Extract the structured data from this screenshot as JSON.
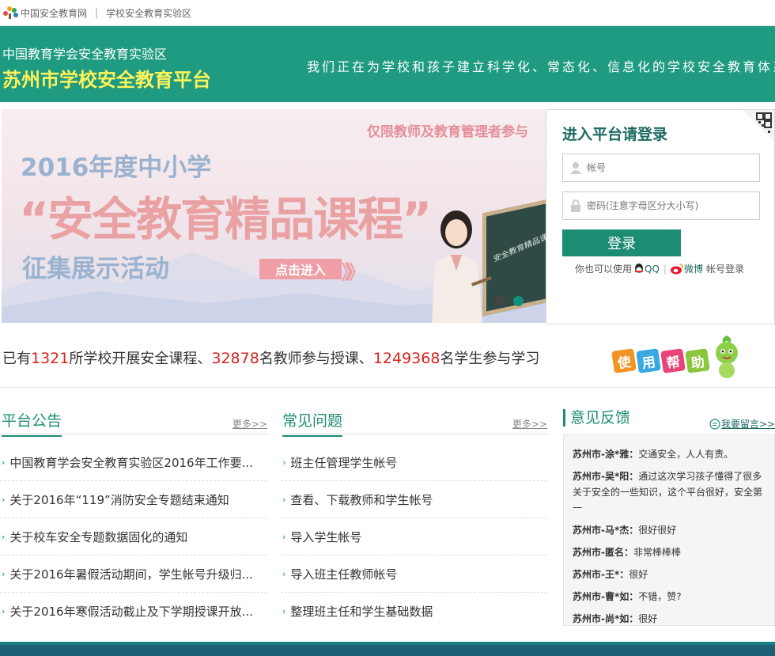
{
  "topbar": {
    "site1": "中国安全教育网",
    "separator": "|",
    "site2": "学校安全教育实验区"
  },
  "header": {
    "org": "中国教育学会安全教育实验区",
    "title": "苏州市学校安全教育平台",
    "slogan": "我们正在为学校和孩子建立科学化、常态化、信息化的学校安全教育体系"
  },
  "banner": {
    "limit_note": "仅限教师及教育管理者参与",
    "year_line": "2016年度中小学",
    "course_line": "“安全教育精品课程”",
    "event_line": "征集展示活动",
    "enter_label": "点击进入",
    "arrows": "》》",
    "board_text": "安全教育精品课"
  },
  "login": {
    "title": "进入平台请登录",
    "account_placeholder": "帐号",
    "password_placeholder": "密码(注意字母区分大小写)",
    "login_label": "登录",
    "alt_prefix": "你也可以使用",
    "qq": "QQ",
    "pipe": "|",
    "weibo": "微博",
    "alt_suffix": "帐号登录"
  },
  "stats": {
    "p1": "已有",
    "schools": "1321",
    "p2": "所学校开展安全课程、",
    "teachers": "32878",
    "p3": "名教师参与授课、",
    "students": "1249368",
    "p4": "名学生参与学习"
  },
  "help": {
    "tiles": [
      "使",
      "用",
      "帮",
      "助"
    ],
    "colors": [
      "#f29423",
      "#3aa9e0",
      "#e9447a",
      "#8cc63f"
    ]
  },
  "announcements": {
    "title": "平台公告",
    "more": "更多>>",
    "items": [
      "中国教育学会安全教育实验区2016年工作要...",
      "关于2016年“119”消防安全专题结束通知",
      "关于校车安全专题数据固化的通知",
      "关于2016年暑假活动期间，学生帐号升级归...",
      "关于2016年寒假活动截止及下学期授课开放..."
    ]
  },
  "faq": {
    "title": "常见问题",
    "more": "更多>>",
    "items": [
      "班主任管理学生帐号",
      "查看、下载教师和学生帐号",
      "导入学生帐号",
      "导入班主任教师帐号",
      "整理班主任和学生基础数据"
    ]
  },
  "feedback": {
    "title": "意见反馈",
    "leave": "我要留言>>",
    "items": [
      {
        "user": "苏州市-涂*雅：",
        "text": "交通安全，人人有责。"
      },
      {
        "user": "苏州市-吴*阳：",
        "text": "通过这次学习孩子懂得了很多关于安全的一些知识，这个平台很好，安全第一"
      },
      {
        "user": "苏州市-马*杰：",
        "text": "很好很好"
      },
      {
        "user": "苏州市-匿名：",
        "text": "非常棒棒棒"
      },
      {
        "user": "苏州市-王*：",
        "text": "很好"
      },
      {
        "user": "苏州市-曹*如：",
        "text": "不错，赞?"
      },
      {
        "user": "苏州市-尚*如：",
        "text": "很好"
      }
    ]
  },
  "colors": {
    "brand_green": "#1e9b80",
    "title_yellow": "#fff35a",
    "stat_red": "#d9231e",
    "footer": "#1d5f77"
  }
}
